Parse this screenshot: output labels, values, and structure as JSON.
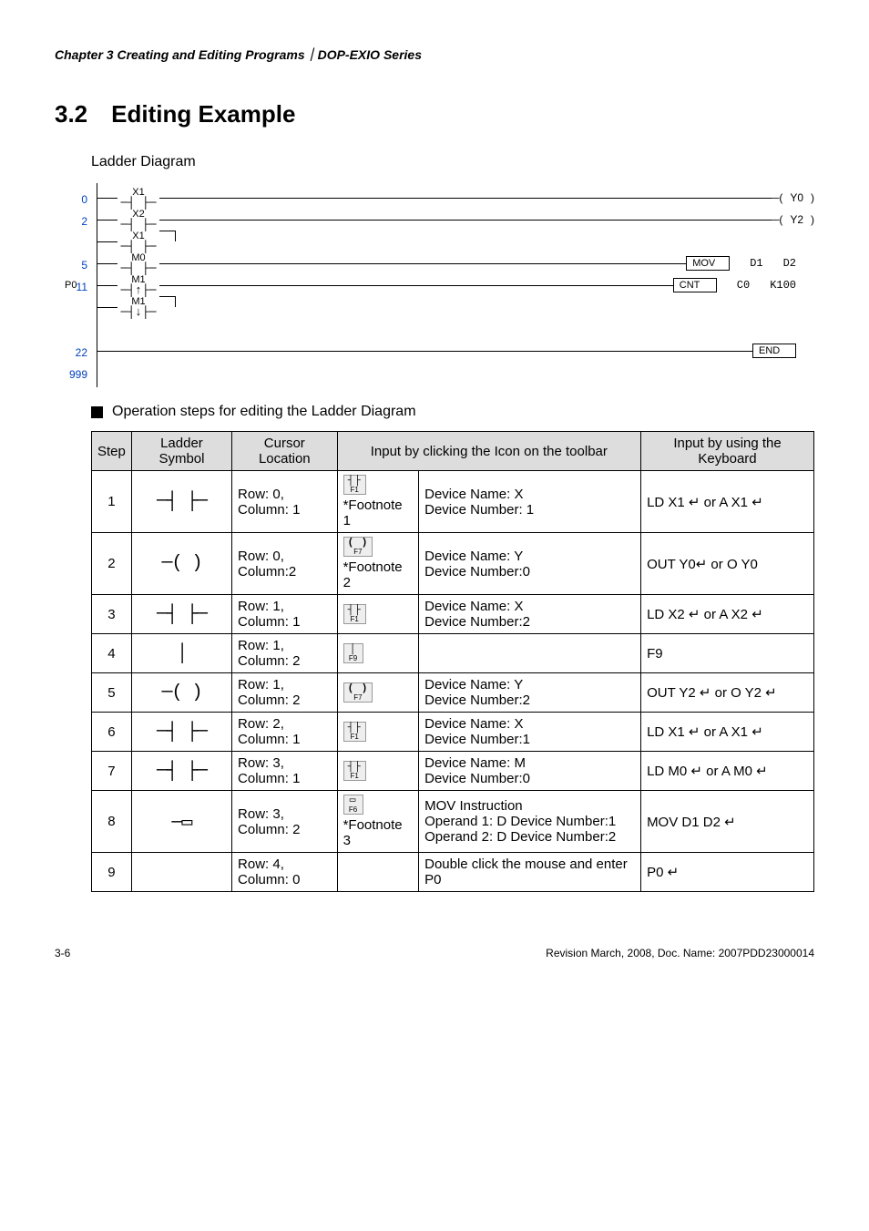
{
  "breadcrumb": "Chapter 3 Creating and Editing Programs｜DOP-EXIO Series",
  "section": {
    "num": "3.2",
    "title": "Editing Example"
  },
  "subhead": "Ladder Diagram",
  "ladder": {
    "lines": [
      "0",
      "2",
      "",
      "5",
      "11",
      "",
      "",
      "22",
      "999"
    ],
    "p0": "P0",
    "contacts": {
      "x1": "X1",
      "x2": "X2",
      "x1b": "X1",
      "m0": "M0",
      "m1": "M1",
      "m1b": "M1"
    },
    "coils": {
      "y0": "Y0",
      "y2": "Y2"
    },
    "mov": {
      "op": "MOV",
      "a": "D1",
      "b": "D2"
    },
    "cnt": {
      "op": "CNT",
      "a": "C0",
      "b": "K100"
    },
    "end": "END"
  },
  "bullet": "Operation steps for editing the Ladder Diagram",
  "headers": {
    "step": "Step",
    "symbol": "Ladder Symbol",
    "cursor": "Cursor Location",
    "toolbar": "Input by clicking the Icon on the toolbar",
    "keyboard": "Input by using the Keyboard"
  },
  "rows": [
    {
      "step": "1",
      "symbol": "no",
      "cursor": "Row: 0,\nColumn: 1",
      "icon": {
        "top": "┤├",
        "bot": "F1"
      },
      "footnote": "*Footnote 1",
      "detail": "Device Name: X\nDevice Number: 1",
      "kb": "LD X1 ↵ or A X1 ↵"
    },
    {
      "step": "2",
      "symbol": "coil",
      "cursor": "Row: 0,\nColumn:2",
      "icon": {
        "top": "( )",
        "bot": "F7"
      },
      "footnote": "*Footnote 2",
      "detail": "Device Name: Y\nDevice Number:0",
      "kb": "OUT Y0↵ or O Y0"
    },
    {
      "step": "3",
      "symbol": "no",
      "cursor": "Row: 1,\nColumn: 1",
      "icon": {
        "top": "┤├",
        "bot": "F1"
      },
      "footnote": "",
      "detail": "Device Name: X\nDevice Number:2",
      "kb": "LD X2 ↵ or A X2 ↵"
    },
    {
      "step": "4",
      "symbol": "vline",
      "cursor": "Row: 1,\nColumn: 2",
      "icon": {
        "top": "│",
        "bot": "F9"
      },
      "footnote": "",
      "detail": "",
      "kb": "F9"
    },
    {
      "step": "5",
      "symbol": "coil",
      "cursor": "Row: 1,\nColumn: 2",
      "icon": {
        "top": "( )",
        "bot": "F7"
      },
      "footnote": "",
      "detail": "Device Name: Y\nDevice Number:2",
      "kb": "OUT Y2 ↵ or O Y2 ↵"
    },
    {
      "step": "6",
      "symbol": "no",
      "cursor": "Row: 2,\nColumn: 1",
      "icon": {
        "top": "┤├",
        "bot": "F1"
      },
      "footnote": "",
      "detail": "Device Name: X\nDevice Number:1",
      "kb": "LD X1 ↵ or A X1 ↵"
    },
    {
      "step": "7",
      "symbol": "no",
      "cursor": "Row: 3,\nColumn: 1",
      "icon": {
        "top": "┤├",
        "bot": "F1"
      },
      "footnote": "",
      "detail": "Device Name: M\nDevice Number:0",
      "kb": "LD M0 ↵ or A M0 ↵"
    },
    {
      "step": "8",
      "symbol": "box",
      "cursor": "Row: 3,\nColumn: 2",
      "icon": {
        "top": "▭",
        "bot": "F6"
      },
      "footnote": "*Footnote 3",
      "detail": "MOV Instruction\nOperand 1: D Device Number:1\nOperand 2: D Device Number:2",
      "kb": "MOV D1 D2   ↵"
    },
    {
      "step": "9",
      "symbol": "",
      "cursor": "Row: 4,\nColumn: 0",
      "icon": null,
      "footnote": "",
      "detail": "Double click the mouse and enter P0",
      "kb": "P0   ↵"
    }
  ],
  "footer": {
    "left": "3-6",
    "right": "Revision March, 2008, Doc. Name: 2007PDD23000014"
  }
}
